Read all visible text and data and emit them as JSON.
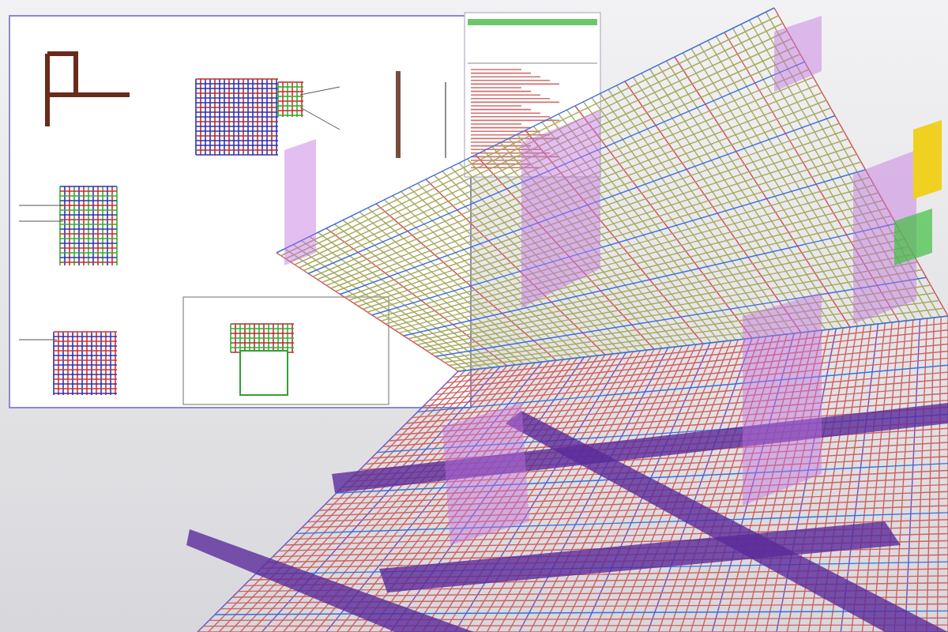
{
  "views": [
    {
      "kind": "drawing-sheet"
    },
    {
      "kind": "schedule-sheet"
    },
    {
      "kind": "rebar-model"
    }
  ]
}
